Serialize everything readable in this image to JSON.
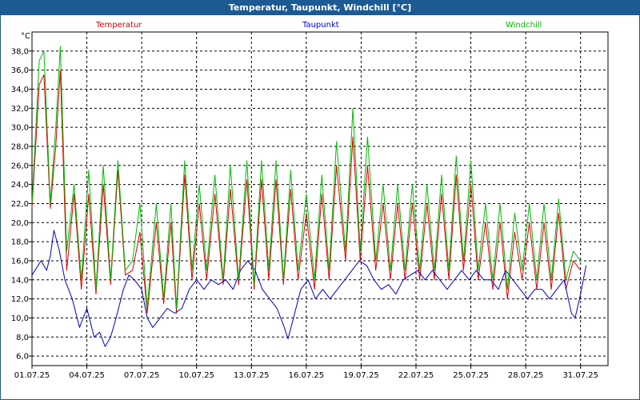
{
  "window": {
    "title": "Temperatur, Taupunkt, Windchill [°C]"
  },
  "colors": {
    "titlebar": "#1c5a94",
    "temperatur": "#dd0000",
    "taupunkt": "#0000cc",
    "windchill": "#00bb00"
  },
  "chart_data": {
    "type": "line",
    "title": "Temperatur, Taupunkt, Windchill [°C]",
    "ylabel": "°C",
    "xlabel": "",
    "ylim": [
      5.0,
      40.0
    ],
    "xlim": [
      0,
      31.5
    ],
    "grid": true,
    "legend_position": "top",
    "y_ticks": [
      "6,0",
      "8,0",
      "10,0",
      "12,0",
      "14,0",
      "16,0",
      "18,0",
      "20,0",
      "22,0",
      "24,0",
      "26,0",
      "28,0",
      "30,0",
      "32,0",
      "34,0",
      "36,0",
      "38,0"
    ],
    "x_ticks": [
      {
        "x": 0,
        "label": "01.07.25"
      },
      {
        "x": 3,
        "label": "04.07.25"
      },
      {
        "x": 6,
        "label": "07.07.25"
      },
      {
        "x": 9,
        "label": "10.07.25"
      },
      {
        "x": 12,
        "label": "13.07.25"
      },
      {
        "x": 15,
        "label": "16.07.25"
      },
      {
        "x": 18,
        "label": "19.07.25"
      },
      {
        "x": 21,
        "label": "22.07.25"
      },
      {
        "x": 24,
        "label": "25.07.25"
      },
      {
        "x": 27,
        "label": "28.07.25"
      },
      {
        "x": 30,
        "label": "31.07.25"
      }
    ],
    "series": [
      {
        "name": "Temperatur",
        "color": "#dd0000",
        "points": [
          [
            0,
            21.5
          ],
          [
            0.4,
            34.5
          ],
          [
            0.65,
            35.5
          ],
          [
            1.0,
            21.5
          ],
          [
            1.3,
            28
          ],
          [
            1.55,
            36
          ],
          [
            1.9,
            15
          ],
          [
            2.3,
            23
          ],
          [
            2.7,
            13
          ],
          [
            3.1,
            23
          ],
          [
            3.5,
            12.5
          ],
          [
            3.9,
            24
          ],
          [
            4.3,
            13.5
          ],
          [
            4.7,
            25.5
          ],
          [
            5.1,
            14.5
          ],
          [
            5.5,
            15
          ],
          [
            5.9,
            19
          ],
          [
            6.3,
            10.5
          ],
          [
            6.8,
            20
          ],
          [
            7.2,
            11.5
          ],
          [
            7.6,
            20
          ],
          [
            7.9,
            10.5
          ],
          [
            8.35,
            25
          ],
          [
            8.75,
            14
          ],
          [
            9.15,
            22
          ],
          [
            9.55,
            14
          ],
          [
            10.0,
            23
          ],
          [
            10.45,
            13.5
          ],
          [
            10.85,
            23.5
          ],
          [
            11.3,
            13.5
          ],
          [
            11.75,
            24.5
          ],
          [
            12.15,
            13
          ],
          [
            12.55,
            24.5
          ],
          [
            12.95,
            14
          ],
          [
            13.35,
            24.5
          ],
          [
            13.75,
            13.5
          ],
          [
            14.15,
            23.5
          ],
          [
            14.55,
            14
          ],
          [
            15.0,
            21
          ],
          [
            15.45,
            13
          ],
          [
            15.85,
            23
          ],
          [
            16.25,
            14
          ],
          [
            16.65,
            26
          ],
          [
            17.15,
            16
          ],
          [
            17.55,
            29
          ],
          [
            17.95,
            16
          ],
          [
            18.35,
            26
          ],
          [
            18.8,
            15
          ],
          [
            19.2,
            22
          ],
          [
            19.6,
            14
          ],
          [
            20.0,
            22
          ],
          [
            20.4,
            14
          ],
          [
            20.8,
            22
          ],
          [
            21.2,
            14
          ],
          [
            21.6,
            22
          ],
          [
            22.0,
            14
          ],
          [
            22.4,
            23
          ],
          [
            22.8,
            14
          ],
          [
            23.2,
            25
          ],
          [
            23.6,
            15
          ],
          [
            24.0,
            24
          ],
          [
            24.4,
            14
          ],
          [
            24.8,
            20
          ],
          [
            25.2,
            13
          ],
          [
            25.6,
            20
          ],
          [
            26.0,
            12
          ],
          [
            26.4,
            19
          ],
          [
            26.8,
            14
          ],
          [
            27.2,
            20
          ],
          [
            27.6,
            13
          ],
          [
            28.0,
            20
          ],
          [
            28.4,
            13
          ],
          [
            28.8,
            21
          ],
          [
            29.2,
            13
          ],
          [
            29.6,
            16
          ],
          [
            30.0,
            15
          ]
        ]
      },
      {
        "name": "Taupunkt",
        "color": "#0000cc",
        "points": [
          [
            0,
            14.5
          ],
          [
            0.5,
            16
          ],
          [
            0.8,
            15
          ],
          [
            1.0,
            16.5
          ],
          [
            1.2,
            19.2
          ],
          [
            1.5,
            17
          ],
          [
            1.8,
            14
          ],
          [
            2.2,
            12
          ],
          [
            2.6,
            9
          ],
          [
            3.0,
            11
          ],
          [
            3.4,
            8
          ],
          [
            3.7,
            8.5
          ],
          [
            4.0,
            7
          ],
          [
            4.3,
            8
          ],
          [
            4.6,
            10
          ],
          [
            5.0,
            13
          ],
          [
            5.3,
            14.5
          ],
          [
            5.6,
            14
          ],
          [
            6.0,
            13
          ],
          [
            6.3,
            10
          ],
          [
            6.6,
            9
          ],
          [
            7.0,
            10
          ],
          [
            7.4,
            11
          ],
          [
            7.8,
            10.5
          ],
          [
            8.2,
            11
          ],
          [
            8.6,
            13
          ],
          [
            9.0,
            14
          ],
          [
            9.4,
            13
          ],
          [
            9.8,
            14
          ],
          [
            10.2,
            13.5
          ],
          [
            10.6,
            14
          ],
          [
            11.0,
            13
          ],
          [
            11.4,
            15
          ],
          [
            11.8,
            16
          ],
          [
            12.2,
            15
          ],
          [
            12.6,
            13
          ],
          [
            13.0,
            12
          ],
          [
            13.4,
            11
          ],
          [
            13.8,
            9
          ],
          [
            14.0,
            7.8
          ],
          [
            14.3,
            10
          ],
          [
            14.7,
            13
          ],
          [
            15.1,
            14
          ],
          [
            15.5,
            12
          ],
          [
            15.9,
            13
          ],
          [
            16.3,
            12
          ],
          [
            16.7,
            13
          ],
          [
            17.1,
            14
          ],
          [
            17.5,
            15
          ],
          [
            17.9,
            16
          ],
          [
            18.3,
            15.5
          ],
          [
            18.7,
            14
          ],
          [
            19.1,
            13
          ],
          [
            19.5,
            13.5
          ],
          [
            19.9,
            12.5
          ],
          [
            20.3,
            14
          ],
          [
            20.7,
            14.5
          ],
          [
            21.1,
            15
          ],
          [
            21.5,
            14
          ],
          [
            21.9,
            15
          ],
          [
            22.3,
            14
          ],
          [
            22.7,
            13
          ],
          [
            23.1,
            14
          ],
          [
            23.5,
            15
          ],
          [
            23.9,
            14
          ],
          [
            24.3,
            15
          ],
          [
            24.7,
            14
          ],
          [
            25.1,
            14
          ],
          [
            25.5,
            13
          ],
          [
            25.9,
            15
          ],
          [
            26.3,
            14
          ],
          [
            26.7,
            13
          ],
          [
            27.1,
            12
          ],
          [
            27.5,
            13
          ],
          [
            27.9,
            13
          ],
          [
            28.3,
            12
          ],
          [
            28.7,
            13
          ],
          [
            29.1,
            14
          ],
          [
            29.5,
            10.5
          ],
          [
            29.7,
            10
          ],
          [
            30.0,
            12.5
          ],
          [
            30.3,
            15.5
          ]
        ]
      },
      {
        "name": "Windchill",
        "color": "#00bb00",
        "points": [
          [
            0,
            22
          ],
          [
            0.4,
            37
          ],
          [
            0.65,
            38
          ],
          [
            1.0,
            22
          ],
          [
            1.3,
            30
          ],
          [
            1.55,
            38.5
          ],
          [
            1.9,
            17
          ],
          [
            2.3,
            24
          ],
          [
            2.7,
            14
          ],
          [
            3.1,
            25.5
          ],
          [
            3.5,
            13
          ],
          [
            3.9,
            26
          ],
          [
            4.3,
            14
          ],
          [
            4.7,
            26.5
          ],
          [
            5.1,
            15
          ],
          [
            5.5,
            16
          ],
          [
            5.9,
            22
          ],
          [
            6.3,
            11
          ],
          [
            6.8,
            22
          ],
          [
            7.2,
            12
          ],
          [
            7.6,
            22
          ],
          [
            7.9,
            11
          ],
          [
            8.35,
            26.5
          ],
          [
            8.75,
            15
          ],
          [
            9.15,
            24
          ],
          [
            9.55,
            15
          ],
          [
            10.0,
            25
          ],
          [
            10.45,
            14
          ],
          [
            10.85,
            26
          ],
          [
            11.3,
            14
          ],
          [
            11.75,
            26.5
          ],
          [
            12.15,
            13.5
          ],
          [
            12.55,
            26.5
          ],
          [
            12.95,
            15
          ],
          [
            13.35,
            26.5
          ],
          [
            13.75,
            14
          ],
          [
            14.15,
            25.5
          ],
          [
            14.55,
            15
          ],
          [
            15.0,
            23
          ],
          [
            15.45,
            14
          ],
          [
            15.85,
            25
          ],
          [
            16.25,
            15
          ],
          [
            16.65,
            28.5
          ],
          [
            17.15,
            17
          ],
          [
            17.55,
            32
          ],
          [
            17.95,
            17
          ],
          [
            18.35,
            29
          ],
          [
            18.8,
            16
          ],
          [
            19.2,
            24
          ],
          [
            19.6,
            15
          ],
          [
            20.0,
            24
          ],
          [
            20.4,
            15
          ],
          [
            20.8,
            24
          ],
          [
            21.2,
            15
          ],
          [
            21.6,
            24
          ],
          [
            22.0,
            15
          ],
          [
            22.4,
            25
          ],
          [
            22.8,
            15
          ],
          [
            23.2,
            27
          ],
          [
            23.6,
            16
          ],
          [
            24.0,
            26.5
          ],
          [
            24.4,
            15
          ],
          [
            24.8,
            22
          ],
          [
            25.2,
            14
          ],
          [
            25.6,
            22
          ],
          [
            26.0,
            13
          ],
          [
            26.4,
            21
          ],
          [
            26.8,
            15
          ],
          [
            27.2,
            22
          ],
          [
            27.6,
            14
          ],
          [
            28.0,
            22
          ],
          [
            28.4,
            14
          ],
          [
            28.8,
            22.5
          ],
          [
            29.2,
            14
          ],
          [
            29.6,
            17
          ],
          [
            30.0,
            16
          ]
        ]
      }
    ]
  }
}
